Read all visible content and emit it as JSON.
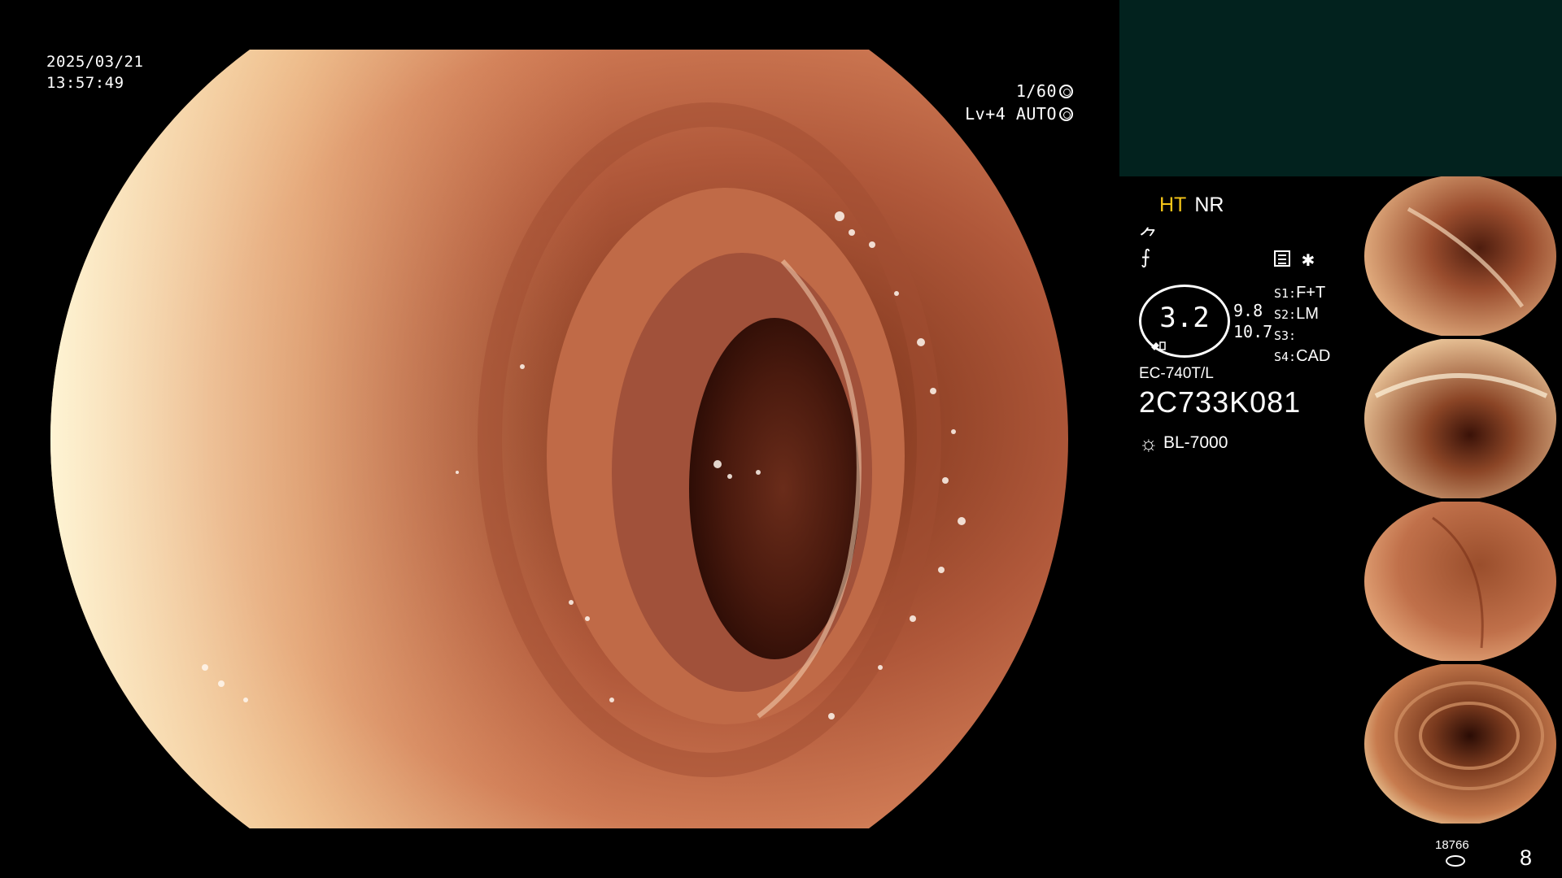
{
  "overlay": {
    "date": "2025/03/21",
    "time": "13:57:49",
    "shutter_speed": "1/60",
    "level": "Lv+4",
    "exposure_mode": "AUTO"
  },
  "panel": {
    "mode_ht": "HT",
    "mode_nr": "NR",
    "glyph_top": "⺈",
    "glyph_bottom": "⨍",
    "zoom_value": "3.2",
    "num_a": "9.8",
    "num_b": "10.7",
    "slots": [
      {
        "key": "S1:",
        "value": "F+T"
      },
      {
        "key": "S2:",
        "value": "LM"
      },
      {
        "key": "S3:",
        "value": ""
      },
      {
        "key": "S4:",
        "value": "CAD"
      }
    ],
    "star": "✱",
    "scope_model": "EC-740T/L",
    "scope_serial": "2C733K081",
    "light_source": "BL-7000"
  },
  "footer": {
    "image_count_small": "18766",
    "image_count_big": "8"
  },
  "colors": {
    "ht_accent": "#f5c518",
    "top_block": "#02221e",
    "mucosa_light": "#f1b98a",
    "mucosa_mid": "#c9744e",
    "mucosa_dark": "#6a2a18"
  }
}
